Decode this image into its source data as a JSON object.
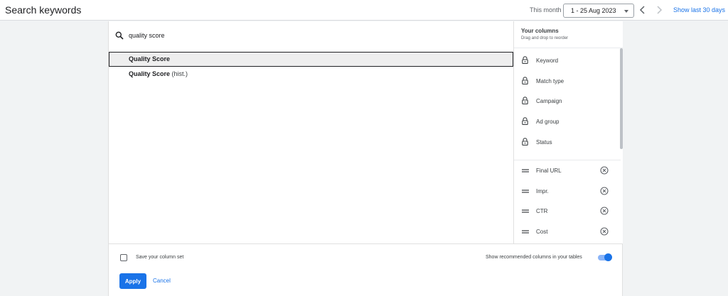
{
  "header": {
    "title": "Search keywords",
    "period_label": "This month",
    "date_range": "1 - 25 Aug 2023",
    "show_last_label": "Show last 30 days"
  },
  "search": {
    "value": "quality score",
    "placeholder": ""
  },
  "results": [
    {
      "bold": "Quality Score",
      "suffix": "",
      "selected": true
    },
    {
      "bold": "Quality Score",
      "suffix": " (hist.)",
      "selected": false
    }
  ],
  "columns_panel": {
    "title": "Your columns",
    "subtitle": "Drag and drop to reorder",
    "locked": [
      "Keyword",
      "Match type",
      "Campaign",
      "Ad group",
      "Status"
    ],
    "removable": [
      "Final URL",
      "Impr.",
      "CTR",
      "Cost"
    ]
  },
  "footer": {
    "save_label": "Save your column set",
    "save_checked": false,
    "recommended_label": "Show recommended columns in your tables",
    "recommended_on": true,
    "apply_label": "Apply",
    "cancel_label": "Cancel"
  },
  "colors": {
    "accent": "#1a73e8",
    "selected_bg": "#eeeeee",
    "toggle_track": "#8ab4f8"
  },
  "icons": {
    "search": "search-icon",
    "lock": "lock-icon",
    "drag": "drag-handle-icon",
    "remove": "remove-circle-icon",
    "prev": "chevron-left-icon",
    "next": "chevron-right-icon"
  }
}
